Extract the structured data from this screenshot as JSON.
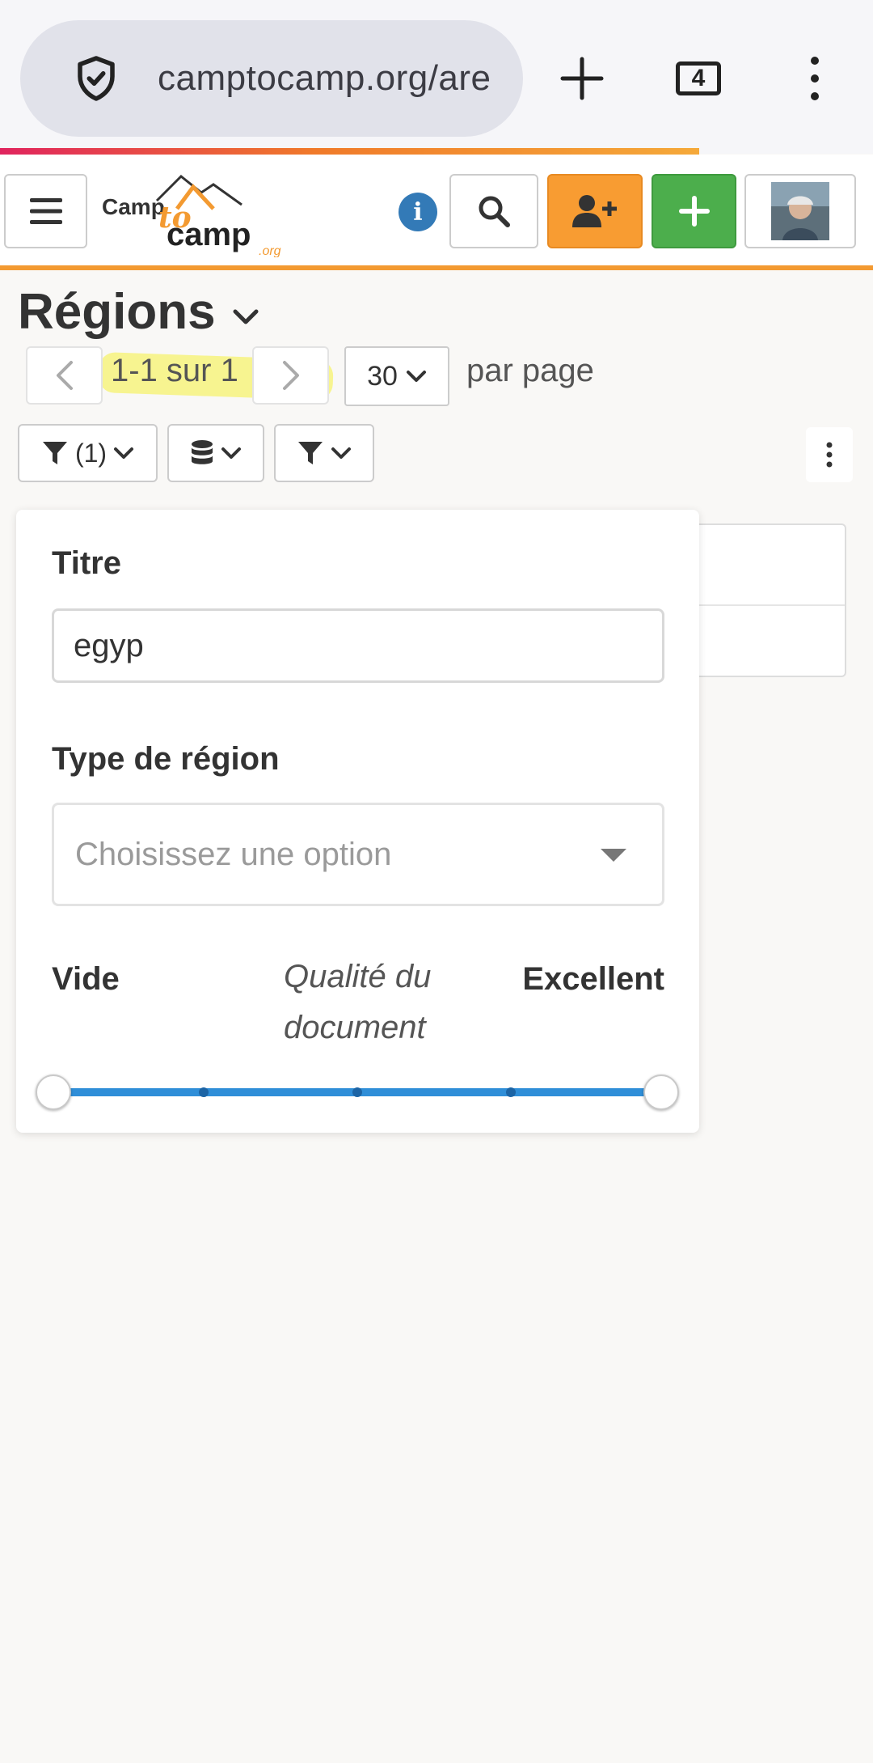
{
  "browser": {
    "url": "camptocamp.org/are",
    "tab_count": "4",
    "new_tab_icon": "plus-icon",
    "menu_icon": "kebab-icon"
  },
  "header": {
    "logo_text": "CamptoCamp.org",
    "info_label": "i",
    "accent_color": "#f39a31",
    "add_user_color": "#f89c32",
    "add_color": "#4cae4c"
  },
  "page": {
    "title": "Régions",
    "pagination": {
      "range": "1-1 sur 1"
    },
    "per_page": {
      "value": "30",
      "label": "par page"
    },
    "filter_button": {
      "count": "(1)"
    }
  },
  "filter_panel": {
    "title_label": "Titre",
    "title_value": "egyp",
    "region_type_label": "Type de région",
    "region_type_placeholder": "Choisissez une option",
    "quality": {
      "min_label": "Vide",
      "center_label": "Qualité du document",
      "max_label": "Excellent",
      "range": [
        0,
        1
      ]
    }
  }
}
